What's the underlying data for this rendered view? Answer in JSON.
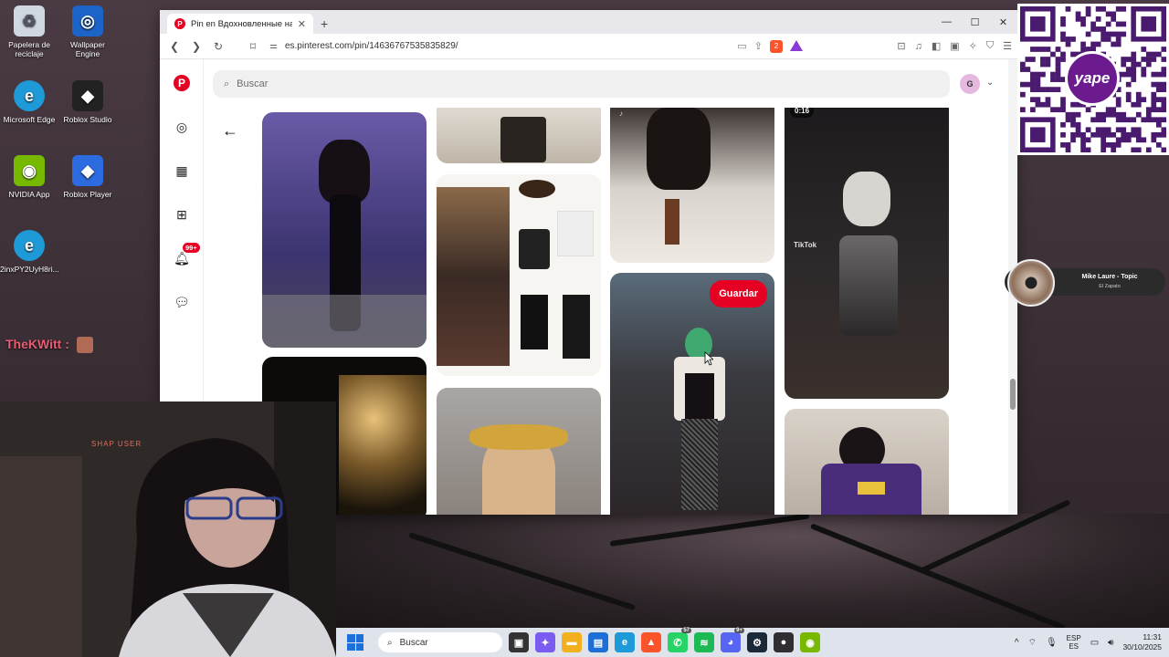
{
  "desktop": {
    "icons": [
      {
        "label": "Papelera de reciclaje",
        "icon": "recycle-bin-icon",
        "color": "#cfd8e0"
      },
      {
        "label": "Wallpaper Engine",
        "icon": "wallpaper-engine-icon",
        "color": "#1c64c8"
      },
      {
        "label": "Microsoft Edge",
        "icon": "edge-icon",
        "color": "#1f9ad8"
      },
      {
        "label": "Roblox Studio",
        "icon": "roblox-studio-icon",
        "color": "#222222"
      },
      {
        "label": "NVIDIA App",
        "icon": "nvidia-icon",
        "color": "#76b900"
      },
      {
        "label": "Roblox Player",
        "icon": "roblox-player-icon",
        "color": "#2c6be0"
      },
      {
        "label": "2inxPY2UyH8ri...",
        "icon": "edge-shortcut-icon",
        "color": "#1f9ad8"
      }
    ],
    "chat_name": "TheKWitt :"
  },
  "browser": {
    "tab_title": "Pin en Вдохновленные наряды",
    "url": "es.pinterest.com/pin/146367675358​35829/",
    "window_controls": [
      "—",
      "☐",
      "✕"
    ]
  },
  "pinterest": {
    "search_placeholder": "Buscar",
    "avatar_letter": "G",
    "notifications_badge": "99+",
    "save_label": "Guardar",
    "video_duration": "0:16",
    "tiktok_label": "TikTok",
    "brand_color": "#e60023"
  },
  "overlay": {
    "now_playing_title": "Mike Laure - Topic",
    "now_playing_artist": "El Zapato",
    "yape_label": "yape",
    "webcam_sign": "SHAP USER"
  },
  "taskbar": {
    "search_label": "Buscar",
    "lang_top": "ESP",
    "lang_bottom": "ES",
    "time": "11:31",
    "date": "30/10/2025",
    "apps": [
      {
        "icon": "file-explorer-dark-icon",
        "color": "#333333",
        "glyph": "▣"
      },
      {
        "icon": "copilot-icon",
        "color": "#7a5cf0",
        "glyph": "✦"
      },
      {
        "icon": "folder-icon",
        "color": "#f2b01e",
        "glyph": "▬"
      },
      {
        "icon": "store-icon",
        "color": "#1d6fd6",
        "glyph": "▤"
      },
      {
        "icon": "edge-icon",
        "color": "#1f9ad8",
        "glyph": "e"
      },
      {
        "icon": "brave-icon",
        "color": "#fb542b",
        "glyph": "▲"
      },
      {
        "icon": "whatsapp-icon",
        "color": "#25d366",
        "glyph": "✆",
        "badge": "57"
      },
      {
        "icon": "spotify-icon",
        "color": "#1db954",
        "glyph": "≋"
      },
      {
        "icon": "discord-icon",
        "color": "#5865f2",
        "glyph": "◕",
        "badge": "9+"
      },
      {
        "icon": "steam-icon",
        "color": "#1b2838",
        "glyph": "⚙"
      },
      {
        "icon": "obs-icon",
        "color": "#302e31",
        "glyph": "●"
      },
      {
        "icon": "nvidia-icon",
        "color": "#76b900",
        "glyph": "◉"
      }
    ]
  }
}
